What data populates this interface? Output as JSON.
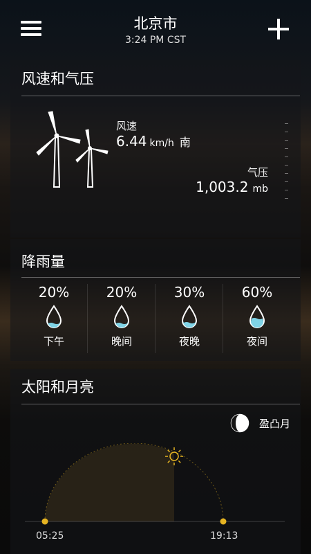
{
  "header": {
    "city": "北京市",
    "time": "3:24 PM CST",
    "menu_icon": "hamburger-menu-icon",
    "add_icon": "plus-icon"
  },
  "wind_pressure": {
    "title": "风速和气压",
    "wind_label": "风速",
    "wind_speed": "6.44",
    "wind_unit": "km/h",
    "wind_direction": "南",
    "pressure_label": "气压",
    "pressure_value": "1,003.2",
    "pressure_unit": "mb",
    "icon": "wind-turbines-icon"
  },
  "precipitation": {
    "title": "降雨量",
    "items": [
      {
        "percent": "20%",
        "period": "下午",
        "fill": 0.2
      },
      {
        "percent": "20%",
        "period": "晚间",
        "fill": 0.2
      },
      {
        "percent": "30%",
        "period": "夜晚",
        "fill": 0.3
      },
      {
        "percent": "60%",
        "period": "夜间",
        "fill": 0.6
      }
    ],
    "icon": "raindrop-icon"
  },
  "sun_moon": {
    "title": "太阳和月亮",
    "moon_phase": "盈凸月",
    "sunrise": "05:25",
    "sunset": "19:13",
    "sun_icon": "sun-icon",
    "moon_icon": "waxing-gibbous-moon-icon"
  },
  "colors": {
    "accent_sun": "#e6b422",
    "water": "#7fd3e6"
  }
}
